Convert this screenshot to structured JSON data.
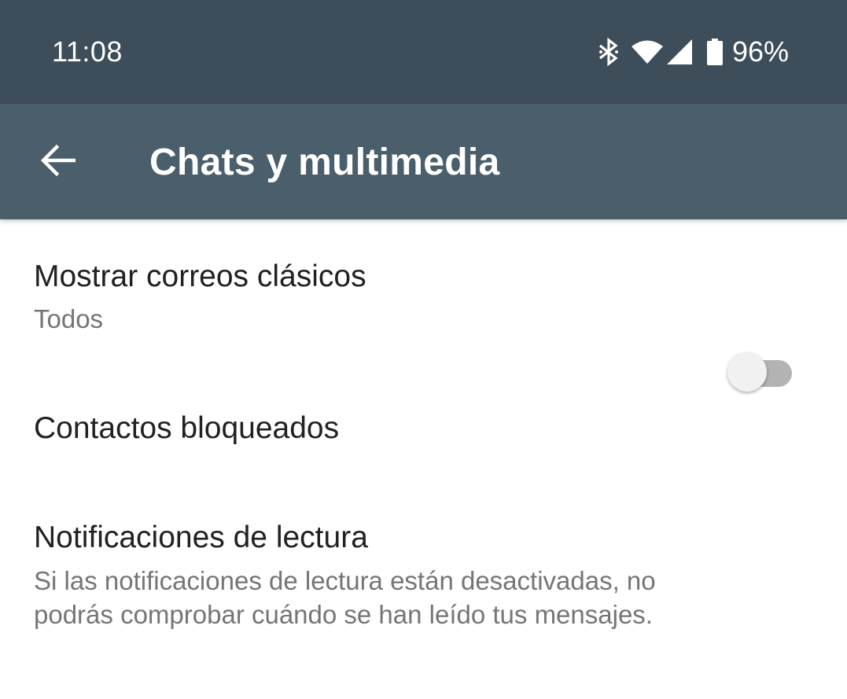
{
  "status_bar": {
    "time": "11:08",
    "battery_percent": "96%",
    "icons": [
      "bluetooth-icon",
      "wifi-icon",
      "cell-signal-icon",
      "battery-icon"
    ]
  },
  "app_bar": {
    "back_icon": "back-arrow-icon",
    "title": "Chats y multimedia"
  },
  "settings": {
    "classic_emails": {
      "title": "Mostrar correos clásicos",
      "summary": "Todos"
    },
    "blocked_contacts": {
      "title": "Contactos bloqueados"
    },
    "read_receipts": {
      "title": "Notificaciones de lectura",
      "summary": "Si las notificaciones de lectura están desactivadas, no podrás comprobar cuándo se han leído tus mensajes.",
      "enabled": false
    }
  },
  "colors": {
    "status_bar": "#3d4d59",
    "app_bar": "#4a5e6b",
    "title_text": "#212121",
    "summary_text": "#757575"
  }
}
